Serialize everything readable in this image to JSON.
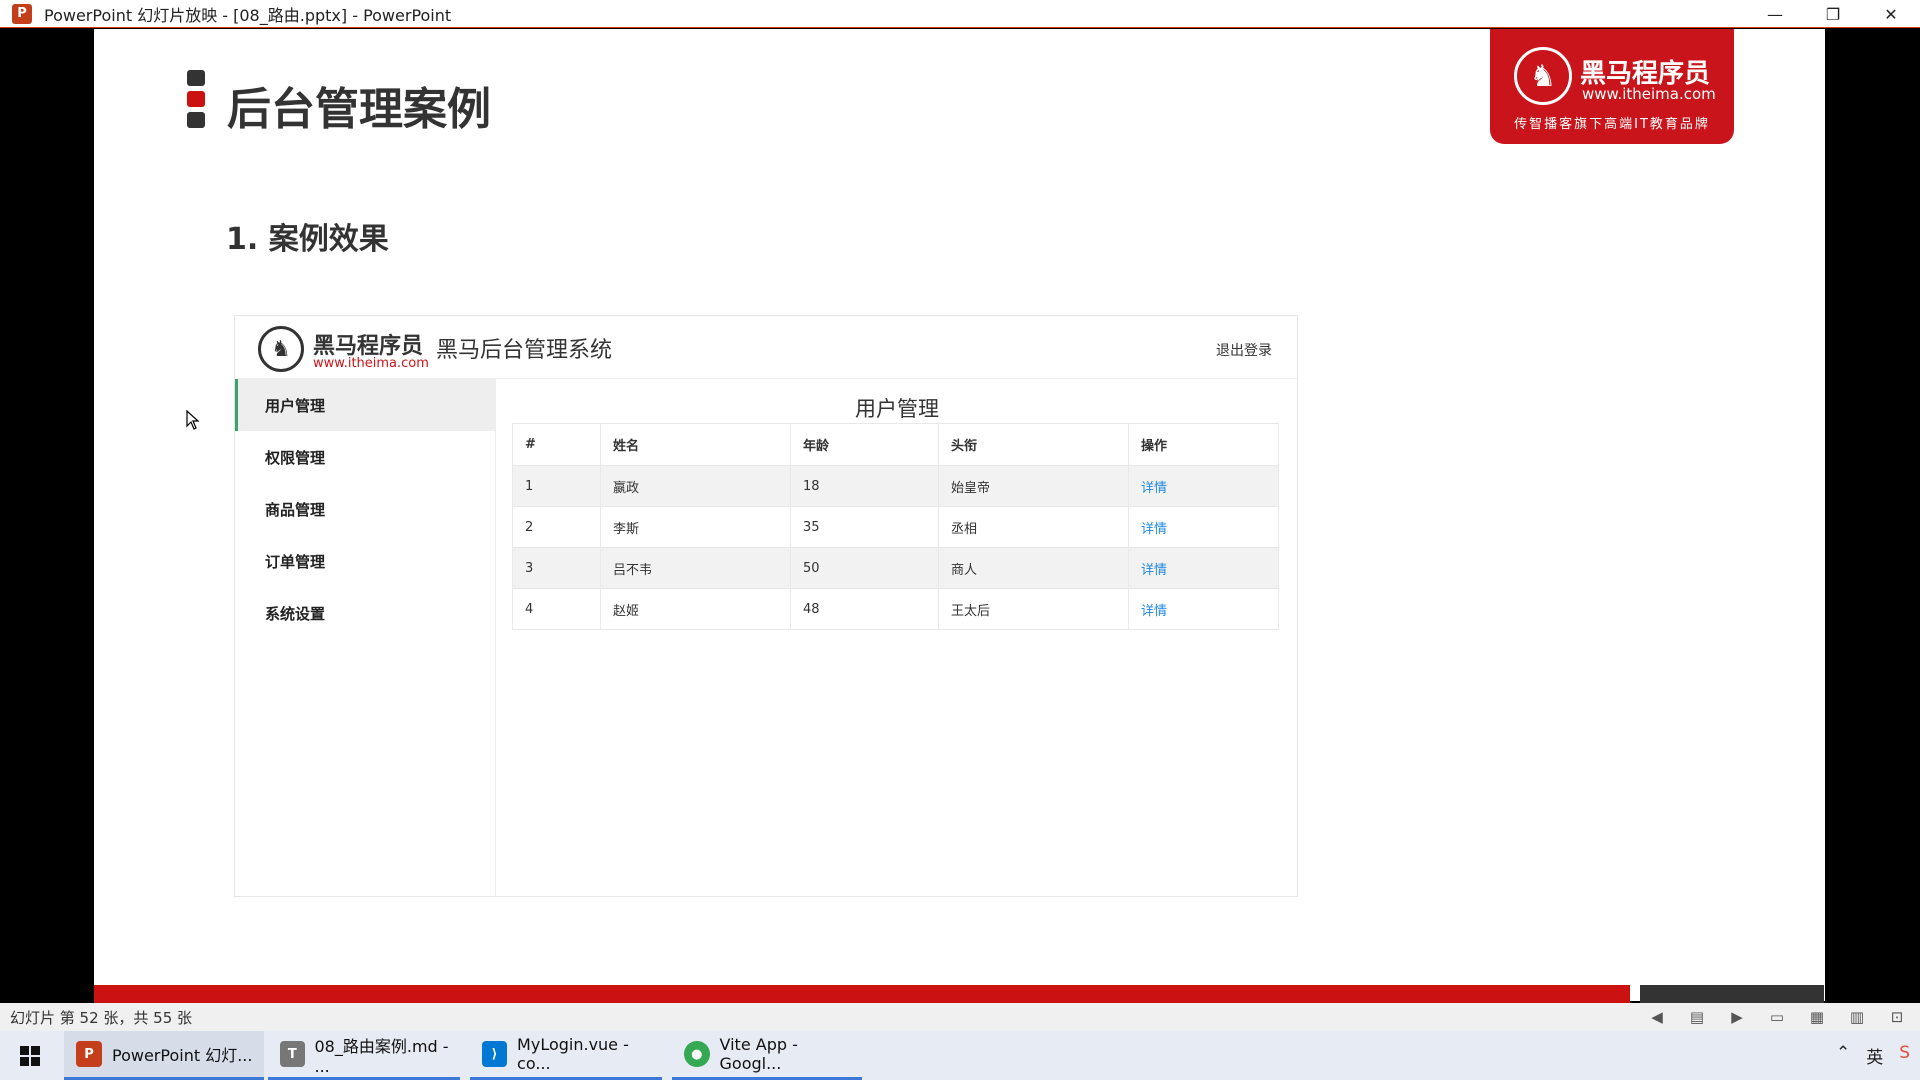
{
  "window": {
    "title": "PowerPoint 幻灯片放映 - [08_路由.pptx] - PowerPoint",
    "app_icon": "P",
    "controls": [
      "—",
      "❐",
      "✕"
    ]
  },
  "slide": {
    "heading": "后台管理案例",
    "bullet_colors": [
      "#333333",
      "#cc1111",
      "#333333"
    ],
    "brand": {
      "name": "黑马程序员",
      "url": "www.itheima.com",
      "slogan": "传智播客旗下高端IT教育品牌"
    },
    "sub_heading": "1. 案例效果",
    "admin": {
      "logo_name": "黑马程序员",
      "logo_url": "www.itheima.com",
      "system_title": "黑马后台管理系统",
      "logout": "退出登录",
      "nav": [
        "用户管理",
        "权限管理",
        "商品管理",
        "订单管理",
        "系统设置"
      ],
      "page_title": "用户管理",
      "table": {
        "headers": [
          "#",
          "姓名",
          "年龄",
          "头衔",
          "操作"
        ],
        "rows": [
          [
            "1",
            "嬴政",
            "18",
            "始皇帝",
            "详情"
          ],
          [
            "2",
            "李斯",
            "35",
            "丞相",
            "详情"
          ],
          [
            "3",
            "吕不韦",
            "50",
            "商人",
            "详情"
          ],
          [
            "4",
            "赵姬",
            "48",
            "王太后",
            "详情"
          ]
        ]
      }
    }
  },
  "statusbar": {
    "slide_count": "幻灯片 第 52 张，共 55 张"
  },
  "taskbar": {
    "items": [
      {
        "label": "PowerPoint 幻灯...",
        "icon": "P",
        "color": "#c43e1c"
      },
      {
        "label": "08_路由案例.md - ...",
        "icon": "T",
        "color": "#777777"
      },
      {
        "label": "MyLogin.vue - co...",
        "icon": "⟩",
        "color": "#0078d4"
      },
      {
        "label": "Vite App - Googl...",
        "icon": "●",
        "color": "#34a853"
      }
    ]
  },
  "colors": {
    "brand_red": "#c8141a",
    "active_nav_border": "#3ea06a",
    "link_blue": "#1e88e5"
  }
}
